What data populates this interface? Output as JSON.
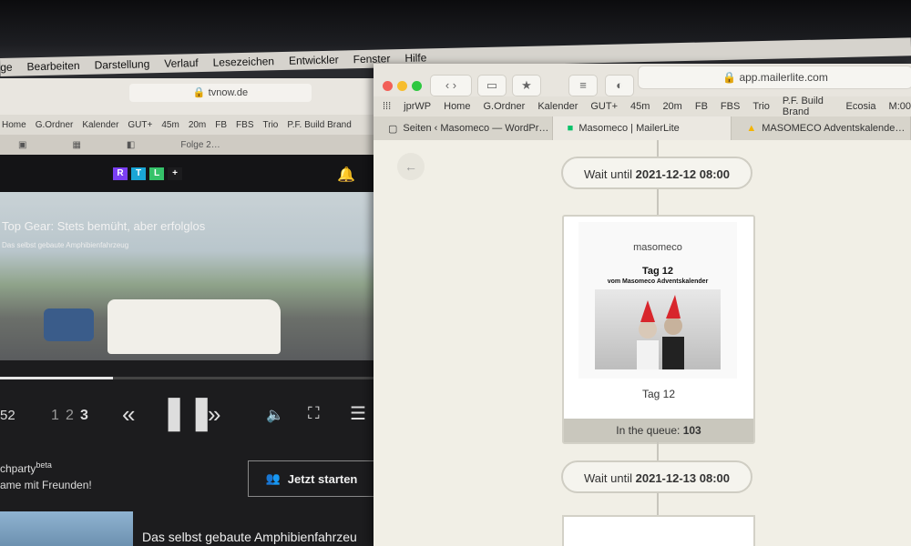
{
  "menu": [
    "ge",
    "Bearbeiten",
    "Darstellung",
    "Verlauf",
    "Lesezeichen",
    "Entwickler",
    "Fenster",
    "Hilfe"
  ],
  "left_browser": {
    "address": "tvnow.de",
    "bookmarks": [
      "Home",
      "G.Ordner",
      "Kalender",
      "GUT+",
      "45m",
      "20m",
      "FB",
      "FBS",
      "Trio",
      "P.F. Build Brand"
    ],
    "tab_label": "Folge 2…",
    "logo_letters": [
      "R",
      "T",
      "L",
      "+"
    ],
    "logo_colors": [
      "#7b3ff2",
      "#1aa6d6",
      "#35c26a",
      "#1c1c1e"
    ],
    "video_title": "Top Gear: Stets bemüht, aber erfolglos",
    "video_subtitle": "Das selbst gebaute Amphibienfahrzeug",
    "episode_numbers": [
      "52",
      "1",
      "2",
      "3"
    ],
    "watchparty": "chparty",
    "watchparty_sup": "beta",
    "watchparty_line2": "ame mit Freunden!",
    "start_button": "Jetzt starten",
    "next_title": "Das selbst gebaute Amphibienfahrzeu",
    "progress": 0.3
  },
  "right_browser": {
    "address": "app.mailerlite.com",
    "bookmarks": [
      "jprWP",
      "Home",
      "G.Ordner",
      "Kalender",
      "GUT+",
      "45m",
      "20m",
      "FB",
      "FBS",
      "Trio",
      "P.F. Build Brand",
      "Ecosia",
      "M:00"
    ],
    "tabs": [
      {
        "label": "Seiten ‹ Masomeco — WordPr…",
        "icon": "wordpress-icon",
        "active": false
      },
      {
        "label": "Masomeco | MailerLite",
        "icon": "mailerlite-icon",
        "active": true
      },
      {
        "label": "MASOMECO Adventskalende…",
        "icon": "google-drive-icon",
        "active": false
      }
    ],
    "wait1_prefix": "Wait until",
    "wait1_date": "2021-12-12 08:00",
    "card": {
      "brand": "masomeco",
      "title": "Tag 12",
      "subtitle": "vom Masomeco Adventskalender",
      "label": "Tag 12",
      "queue_prefix": "In the queue:",
      "queue_count": "103"
    },
    "wait2_prefix": "Wait until",
    "wait2_date": "2021-12-13 08:00"
  }
}
